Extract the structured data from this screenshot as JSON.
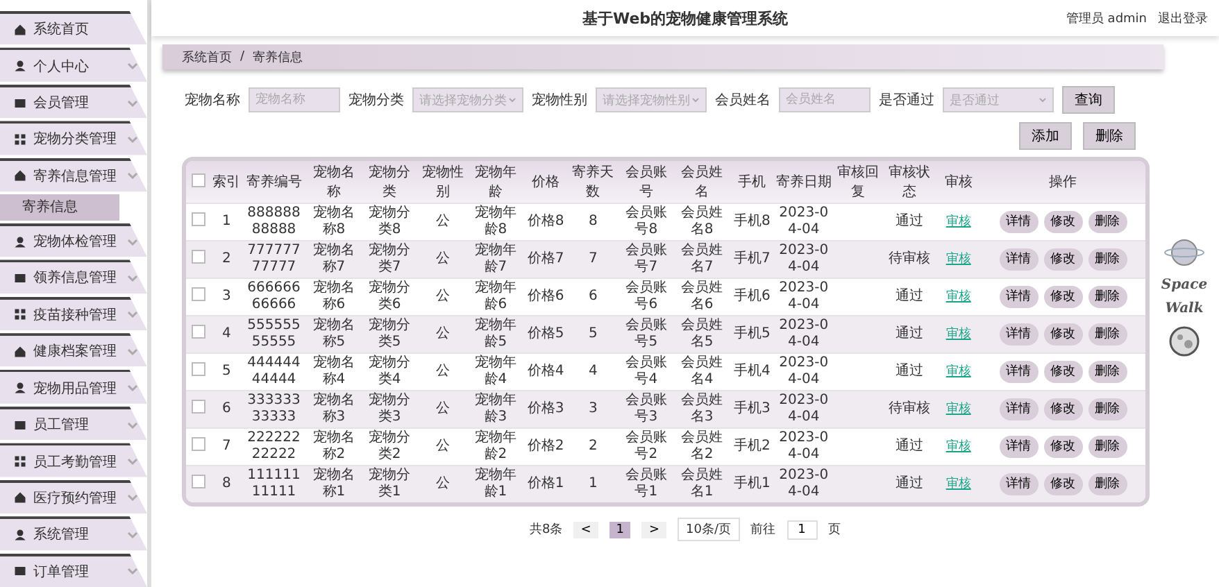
{
  "header": {
    "title": "基于Web的宠物健康管理系统",
    "user": "管理员 admin",
    "logout": "退出登录"
  },
  "sidebar": {
    "items": [
      {
        "label": "系统首页",
        "selected": false
      },
      {
        "label": "个人中心",
        "selected": false
      },
      {
        "label": "会员管理",
        "selected": false
      },
      {
        "label": "宠物分类管理",
        "selected": false
      },
      {
        "label": "寄养信息管理",
        "selected": false,
        "children": [
          {
            "label": "寄养信息",
            "selected": true
          }
        ]
      },
      {
        "label": "宠物体检管理",
        "selected": false
      },
      {
        "label": "领养信息管理",
        "selected": false
      },
      {
        "label": "疫苗接种管理",
        "selected": false
      },
      {
        "label": "健康档案管理",
        "selected": false
      },
      {
        "label": "宠物用品管理",
        "selected": false
      },
      {
        "label": "员工管理",
        "selected": false
      },
      {
        "label": "员工考勤管理",
        "selected": false
      },
      {
        "label": "医疗预约管理",
        "selected": false
      },
      {
        "label": "系统管理",
        "selected": false
      },
      {
        "label": "订单管理",
        "selected": false
      }
    ]
  },
  "breadcrumb": {
    "items": [
      "系统首页",
      "寄养信息"
    ],
    "separator": "/"
  },
  "filters": [
    {
      "kind": "input",
      "label": "宠物名称",
      "placeholder": "宠物名称"
    },
    {
      "kind": "select",
      "label": "宠物分类",
      "placeholder": "请选择宠物分类"
    },
    {
      "kind": "select",
      "label": "宠物性别",
      "placeholder": "请选择宠物性别"
    },
    {
      "kind": "input",
      "label": "会员姓名",
      "placeholder": "会员姓名"
    },
    {
      "kind": "select",
      "label": "是否通过",
      "placeholder": "是否通过"
    }
  ],
  "search_button": "查询",
  "toolbar": [
    "添加",
    "删除"
  ],
  "table": {
    "select_all_checked": false,
    "columns": [
      "索引",
      "寄养编号",
      "宠物名称",
      "宠物分类",
      "宠物性别",
      "宠物年龄",
      "价格",
      "寄养天数",
      "会员账号",
      "会员姓名",
      "手机",
      "寄养日期",
      "审核回复",
      "审核状态",
      "审核",
      "操作"
    ],
    "rows": [
      {
        "checked": false,
        "cells": [
          "1",
          "88888888888",
          "宠物名称8",
          "宠物分类8",
          "公",
          "宠物年龄8",
          "价格8",
          "8",
          "会员账号8",
          "会员姓名8",
          "手机8",
          "2023-04-04",
          "通过"
        ],
        "review": "审核",
        "actions": [
          "详情",
          "修改",
          "删除"
        ]
      },
      {
        "checked": false,
        "cells": [
          "2",
          "77777777777",
          "宠物名称7",
          "宠物分类7",
          "公",
          "宠物年龄7",
          "价格7",
          "7",
          "会员账号7",
          "会员姓名7",
          "手机7",
          "2023-04-04",
          "待审核"
        ],
        "review": "审核",
        "actions": [
          "详情",
          "修改",
          "删除"
        ]
      },
      {
        "checked": false,
        "cells": [
          "3",
          "66666666666",
          "宠物名称6",
          "宠物分类6",
          "公",
          "宠物年龄6",
          "价格6",
          "6",
          "会员账号6",
          "会员姓名6",
          "手机6",
          "2023-04-04",
          "通过"
        ],
        "review": "审核",
        "actions": [
          "详情",
          "修改",
          "删除"
        ]
      },
      {
        "checked": false,
        "cells": [
          "4",
          "55555555555",
          "宠物名称5",
          "宠物分类5",
          "公",
          "宠物年龄5",
          "价格5",
          "5",
          "会员账号5",
          "会员姓名5",
          "手机5",
          "2023-04-04",
          "通过"
        ],
        "review": "审核",
        "actions": [
          "详情",
          "修改",
          "删除"
        ]
      },
      {
        "checked": false,
        "cells": [
          "5",
          "44444444444",
          "宠物名称4",
          "宠物分类4",
          "公",
          "宠物年龄4",
          "价格4",
          "4",
          "会员账号4",
          "会员姓名4",
          "手机4",
          "2023-04-04",
          "通过"
        ],
        "review": "审核",
        "actions": [
          "详情",
          "修改",
          "删除"
        ]
      },
      {
        "checked": false,
        "cells": [
          "6",
          "33333333333",
          "宠物名称3",
          "宠物分类3",
          "公",
          "宠物年龄3",
          "价格3",
          "3",
          "会员账号3",
          "会员姓名3",
          "手机3",
          "2023-04-04",
          "待审核"
        ],
        "review": "审核",
        "actions": [
          "详情",
          "修改",
          "删除"
        ]
      },
      {
        "checked": false,
        "cells": [
          "7",
          "22222222222",
          "宠物名称2",
          "宠物分类2",
          "公",
          "宠物年龄2",
          "价格2",
          "2",
          "会员账号2",
          "会员姓名2",
          "手机2",
          "2023-04-04",
          "通过"
        ],
        "review": "审核",
        "actions": [
          "详情",
          "修改",
          "删除"
        ]
      },
      {
        "checked": false,
        "cells": [
          "8",
          "11111111111",
          "宠物名称1",
          "宠物分类1",
          "公",
          "宠物年龄1",
          "价格1",
          "1",
          "会员账号1",
          "会员姓名1",
          "手机1",
          "2023-04-04",
          "通过"
        ],
        "review": "审核",
        "actions": [
          "详情",
          "修改",
          "删除"
        ]
      }
    ]
  },
  "pagination": {
    "total": "共8条",
    "prev": "<",
    "pages": [
      {
        "label": "1",
        "selected": true
      }
    ],
    "next": ">",
    "page_size": "10条/页",
    "goto": "前往",
    "goto_value": "1",
    "page_unit": "页"
  },
  "decoration": {
    "text_1": "Space",
    "text_2": "Walk"
  }
}
